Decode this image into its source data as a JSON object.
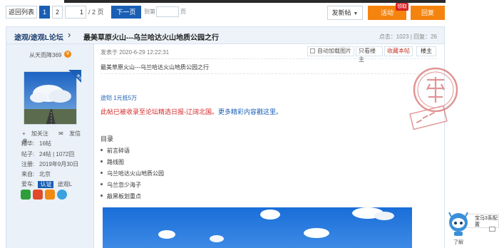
{
  "pager": {
    "back_label": "返回列表",
    "current_page": "1",
    "page2": "2",
    "input_value": "1",
    "total_label": "/ 2 页",
    "next_label": "下一页",
    "goto_label": "到第",
    "goto_suffix": "页"
  },
  "actions": {
    "new_post_label": "发新帖",
    "activity_label": "活动",
    "activity_badge": "领取",
    "reply_label": "回复"
  },
  "thread": {
    "breadcrumb": "途观/途观L论坛",
    "title": "最美草原火山---乌兰哈达火山地质公园之行",
    "views_label": "点击：",
    "views": "1023",
    "replies_label": "回复：",
    "replies": "26"
  },
  "author": {
    "name": "从天而降369",
    "vip_badge": "V",
    "floor_owner_badge": "楼主",
    "follow_label": "加关注",
    "message_label": "发信息",
    "stats": [
      {
        "key": "精华:",
        "value": "16帖"
      },
      {
        "key": "帖子:",
        "value": "24帖 | 1072回"
      },
      {
        "key": "注册:",
        "value": "2019年9月30日"
      },
      {
        "key": "来自:",
        "value": "北京"
      }
    ],
    "car_label": "爱车:",
    "certified_label": "认证",
    "car_model": "途观L"
  },
  "post": {
    "time": "发表于 2020-6-29 12:22:31",
    "auto_load_images_label": "自动加载图片",
    "only_host_label": "只看楼主",
    "favorite_label": "收藏本帖",
    "floor_label": "楼主",
    "title": "最美草原火山---乌兰哈达火山地质公园之行",
    "ad_line": "途铠 1元抵5万",
    "notice_red": "此帖已被收录至论坛精选日报-辽阔北国。",
    "notice_blue": "更多精彩内容戳这里。",
    "toc_heading": "目录",
    "toc_items": [
      "前言碎语",
      "路线图",
      "乌兰哈达火山地质公园",
      "乌兰忽少海子",
      "敲黑板划重点"
    ]
  },
  "helper": {
    "bubble_text": "宝马3系配置",
    "label": "了解"
  },
  "colors": {
    "primary_blue": "#1a5fb4",
    "accent_orange": "#f5840e",
    "header_bg": "#eef3f9",
    "author_bg": "#eaf1f8",
    "notice_red": "#d42a2a",
    "stamp_red": "#c94040"
  }
}
